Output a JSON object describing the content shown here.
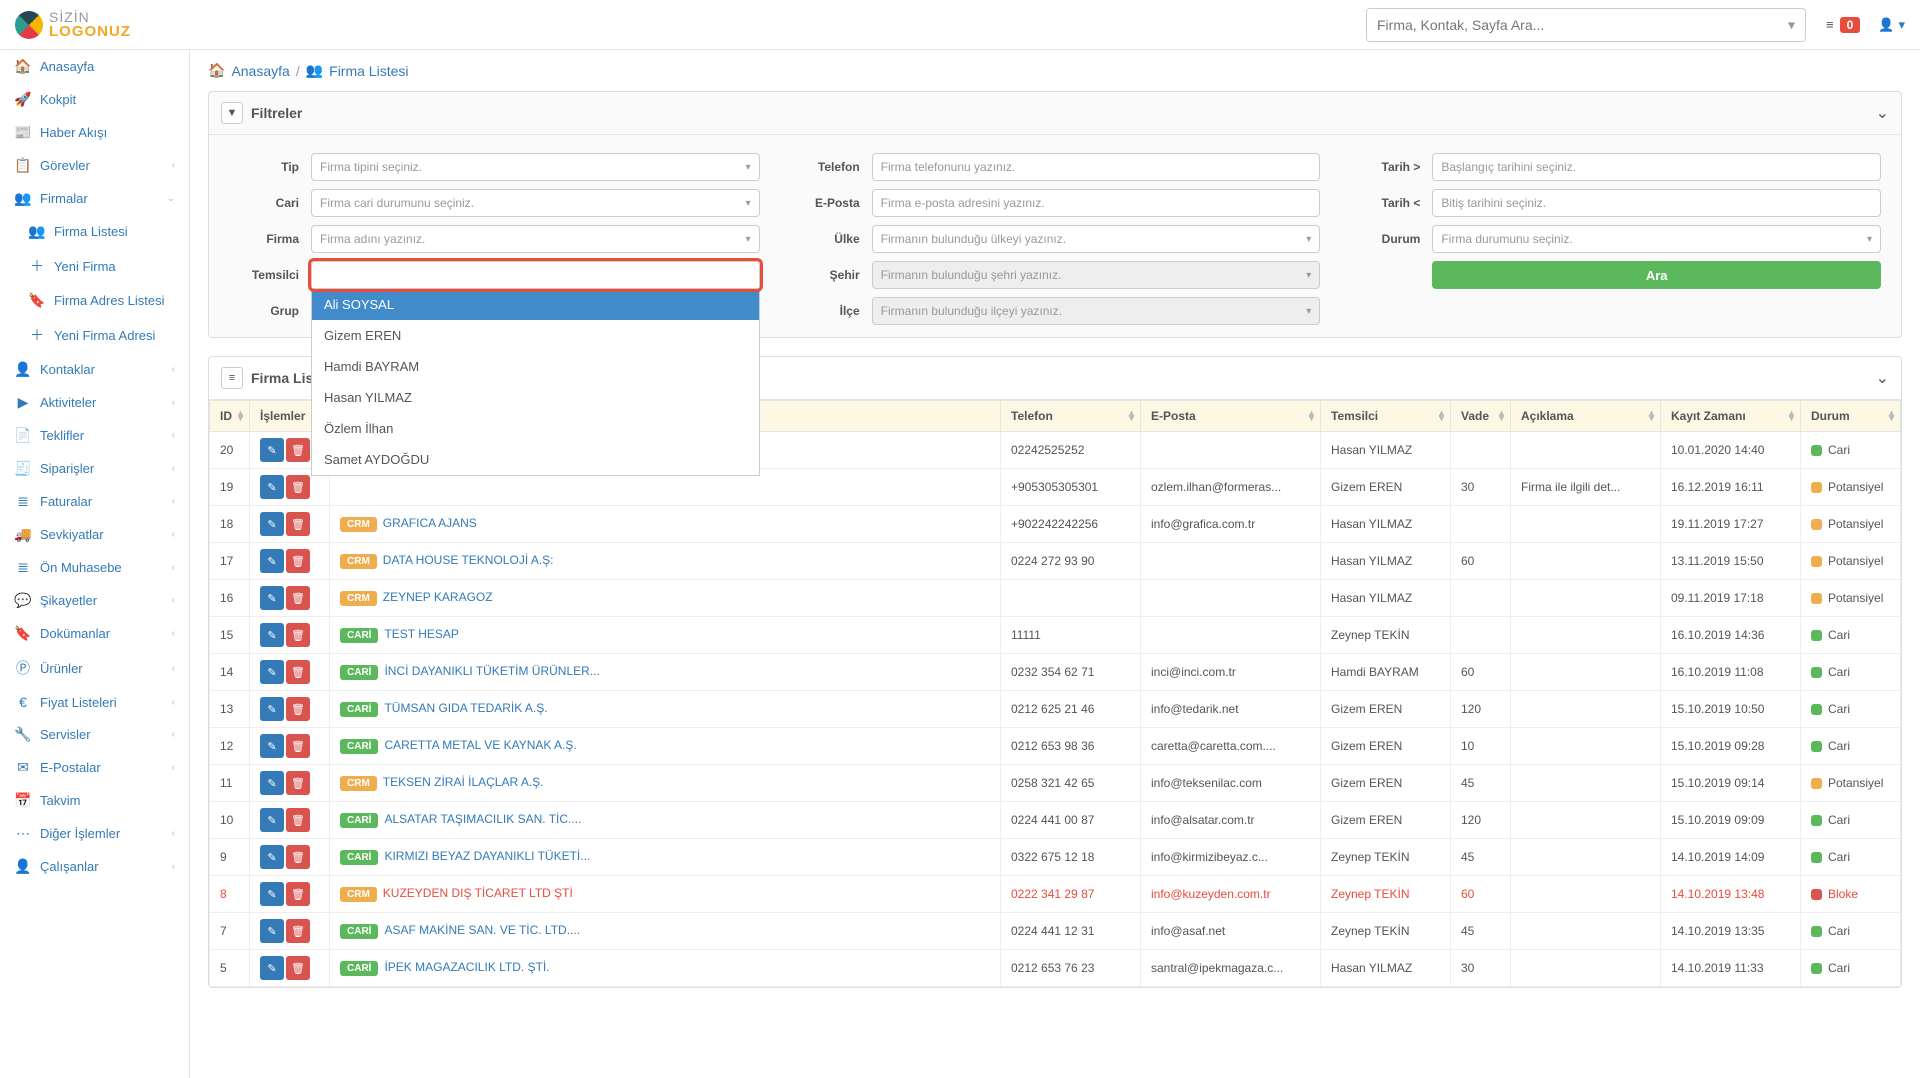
{
  "header": {
    "logo1": "SİZİN",
    "logo2": "LOGONUZ",
    "search_placeholder": "Firma, Kontak, Sayfa Ara...",
    "notif_count": "0"
  },
  "sidebar": {
    "items": [
      {
        "icon": "🏠",
        "label": "Anasayfa",
        "chev": false
      },
      {
        "icon": "🚀",
        "label": "Kokpit",
        "chev": false
      },
      {
        "icon": "📰",
        "label": "Haber Akışı",
        "chev": false
      },
      {
        "icon": "📋",
        "label": "Görevler",
        "chev": true
      },
      {
        "icon": "👥",
        "label": "Firmalar",
        "chev": true,
        "expanded": true,
        "subs": [
          {
            "icon": "👥",
            "label": "Firma Listesi"
          },
          {
            "icon": "＋",
            "label": "Yeni Firma"
          },
          {
            "icon": "🔖",
            "label": "Firma Adres Listesi"
          },
          {
            "icon": "＋",
            "label": "Yeni Firma Adresi"
          }
        ]
      },
      {
        "icon": "👤",
        "label": "Kontaklar",
        "chev": true
      },
      {
        "icon": "▶",
        "label": "Aktiviteler",
        "chev": true
      },
      {
        "icon": "📄",
        "label": "Teklifler",
        "chev": true
      },
      {
        "icon": "🧾",
        "label": "Siparişler",
        "chev": true
      },
      {
        "icon": "≣",
        "label": "Faturalar",
        "chev": true
      },
      {
        "icon": "🚚",
        "label": "Sevkiyatlar",
        "chev": true
      },
      {
        "icon": "≣",
        "label": "Ön Muhasebe",
        "chev": true
      },
      {
        "icon": "💬",
        "label": "Şikayetler",
        "chev": true
      },
      {
        "icon": "🔖",
        "label": "Dokümanlar",
        "chev": true
      },
      {
        "icon": "Ⓟ",
        "label": "Ürünler",
        "chev": true
      },
      {
        "icon": "€",
        "label": "Fiyat Listeleri",
        "chev": true
      },
      {
        "icon": "🔧",
        "label": "Servisler",
        "chev": true
      },
      {
        "icon": "✉",
        "label": "E-Postalar",
        "chev": true
      },
      {
        "icon": "📅",
        "label": "Takvim",
        "chev": false
      },
      {
        "icon": "⋯",
        "label": "Diğer İşlemler",
        "chev": true
      },
      {
        "icon": "👤",
        "label": "Çalışanlar",
        "chev": true
      }
    ]
  },
  "breadcrumb": {
    "home": "Anasayfa",
    "current": "Firma Listesi"
  },
  "filters": {
    "title": "Filtreler",
    "labels": {
      "tip": "Tip",
      "cari": "Cari",
      "firma": "Firma",
      "temsilci": "Temsilci",
      "grup": "Grup",
      "telefon": "Telefon",
      "eposta": "E-Posta",
      "ulke": "Ülke",
      "sehir": "Şehir",
      "ilce": "İlçe",
      "tarih_gt": "Tarih >",
      "tarih_lt": "Tarih <",
      "durum": "Durum",
      "ara": "Ara"
    },
    "placeholders": {
      "tip": "Firma tipini seçiniz.",
      "cari": "Firma cari durumunu seçiniz.",
      "firma": "Firma adını yazınız.",
      "grup": "",
      "telefon": "Firma telefonunu yazınız.",
      "eposta": "Firma e-posta adresini yazınız.",
      "ulke": "Firmanın bulunduğu ülkeyi yazınız.",
      "sehir": "Firmanın bulunduğu şehri yazınız.",
      "ilce": "Firmanın bulunduğu ilçeyi yazınız.",
      "tarih_gt": "Başlangıç tarihini seçiniz.",
      "tarih_lt": "Bitiş tarihini seçiniz.",
      "durum": "Firma durumunu seçiniz."
    },
    "temsilci_options": [
      "Ali SOYSAL",
      "Gizem EREN",
      "Hamdi BAYRAM",
      "Hasan YILMAZ",
      "Özlem İlhan",
      "Samet AYDOĞDU"
    ]
  },
  "table": {
    "title": "Firma Listes",
    "columns": [
      "ID",
      "İşlemler",
      "",
      "Telefon",
      "E-Posta",
      "Temsilci",
      "Vade",
      "Açıklama",
      "Kayıt Zamanı",
      "Durum"
    ],
    "rows": [
      {
        "id": "20",
        "tag": "",
        "name": "",
        "phone": "02242525252",
        "email": "",
        "rep": "Hasan YILMAZ",
        "vade": "",
        "note": "",
        "time": "10.01.2020 14:40",
        "status": "Cari",
        "dot": "green"
      },
      {
        "id": "19",
        "tag": "",
        "name": "",
        "phone": "+905305305301",
        "email": "ozlem.ilhan@formeras...",
        "rep": "Gizem EREN",
        "vade": "30",
        "note": "Firma ile ilgili det...",
        "time": "16.12.2019 16:11",
        "status": "Potansiyel",
        "dot": "orange"
      },
      {
        "id": "18",
        "tag": "CRM",
        "name": "GRAFICA AJANS",
        "phone": "+902242242256",
        "email": "info@grafica.com.tr",
        "rep": "Hasan YILMAZ",
        "vade": "",
        "note": "",
        "time": "19.11.2019 17:27",
        "status": "Potansiyel",
        "dot": "orange"
      },
      {
        "id": "17",
        "tag": "CRM",
        "name": "DATA HOUSE TEKNOLOJİ A.Ş:",
        "phone": "0224 272 93 90",
        "email": "",
        "rep": "Hasan YILMAZ",
        "vade": "60",
        "note": "",
        "time": "13.11.2019 15:50",
        "status": "Potansiyel",
        "dot": "orange"
      },
      {
        "id": "16",
        "tag": "CRM",
        "name": "ZEYNEP KARAGOZ",
        "phone": "",
        "email": "",
        "rep": "Hasan YILMAZ",
        "vade": "",
        "note": "",
        "time": "09.11.2019 17:18",
        "status": "Potansiyel",
        "dot": "orange"
      },
      {
        "id": "15",
        "tag": "CARİ",
        "name": "TEST HESAP",
        "phone": "11111",
        "email": "",
        "rep": "Zeynep TEKİN",
        "vade": "",
        "note": "",
        "time": "16.10.2019 14:36",
        "status": "Cari",
        "dot": "green"
      },
      {
        "id": "14",
        "tag": "CARİ",
        "name": "İNCİ DAYANIKLI TÜKETİM ÜRÜNLER...",
        "phone": "0232 354 62 71",
        "email": "inci@inci.com.tr",
        "rep": "Hamdi BAYRAM",
        "vade": "60",
        "note": "",
        "time": "16.10.2019 11:08",
        "status": "Cari",
        "dot": "green"
      },
      {
        "id": "13",
        "tag": "CARİ",
        "name": "TÜMSAN GIDA TEDARİK A.Ş.",
        "phone": "0212 625 21 46",
        "email": "info@tedarik.net",
        "rep": "Gizem EREN",
        "vade": "120",
        "note": "",
        "time": "15.10.2019 10:50",
        "status": "Cari",
        "dot": "green"
      },
      {
        "id": "12",
        "tag": "CARİ",
        "name": "CARETTA METAL VE KAYNAK A.Ş.",
        "phone": "0212 653 98 36",
        "email": "caretta@caretta.com....",
        "rep": "Gizem EREN",
        "vade": "10",
        "note": "",
        "time": "15.10.2019 09:28",
        "status": "Cari",
        "dot": "green"
      },
      {
        "id": "11",
        "tag": "CRM",
        "name": "TEKSEN ZİRAİ İLAÇLAR A.Ş.",
        "phone": "0258 321 42 65",
        "email": "info@teksenilac.com",
        "rep": "Gizem EREN",
        "vade": "45",
        "note": "",
        "time": "15.10.2019 09:14",
        "status": "Potansiyel",
        "dot": "orange"
      },
      {
        "id": "10",
        "tag": "CARİ",
        "name": "ALSATAR TAŞIMACILIK SAN. TİC....",
        "phone": "0224 441 00 87",
        "email": "info@alsatar.com.tr",
        "rep": "Gizem EREN",
        "vade": "120",
        "note": "",
        "time": "15.10.2019 09:09",
        "status": "Cari",
        "dot": "green"
      },
      {
        "id": "9",
        "tag": "CARİ",
        "name": "KIRMIZI BEYAZ DAYANIKLI TÜKETİ...",
        "phone": "0322 675 12 18",
        "email": "info@kirmizibeyaz.c...",
        "rep": "Zeynep TEKİN",
        "vade": "45",
        "note": "",
        "time": "14.10.2019 14:09",
        "status": "Cari",
        "dot": "green"
      },
      {
        "id": "8",
        "tag": "CRM",
        "name": "KUZEYDEN DIŞ TİCARET LTD ŞTİ",
        "phone": "0222 341 29 87",
        "email": "info@kuzeyden.com.tr",
        "rep": "Zeynep TEKİN",
        "vade": "60",
        "note": "",
        "time": "14.10.2019 13:48",
        "status": "Bloke",
        "dot": "red",
        "red": true
      },
      {
        "id": "7",
        "tag": "CARİ",
        "name": "ASAF MAKİNE SAN. VE TİC. LTD....",
        "phone": "0224 441 12 31",
        "email": "info@asaf.net",
        "rep": "Zeynep TEKİN",
        "vade": "45",
        "note": "",
        "time": "14.10.2019 13:35",
        "status": "Cari",
        "dot": "green"
      },
      {
        "id": "5",
        "tag": "CARİ",
        "name": "İPEK MAGAZACILIK LTD. ŞTİ.",
        "phone": "0212 653 76 23",
        "email": "santral@ipekmagaza.c...",
        "rep": "Hasan YILMAZ",
        "vade": "30",
        "note": "",
        "time": "14.10.2019 11:33",
        "status": "Cari",
        "dot": "green"
      }
    ]
  }
}
